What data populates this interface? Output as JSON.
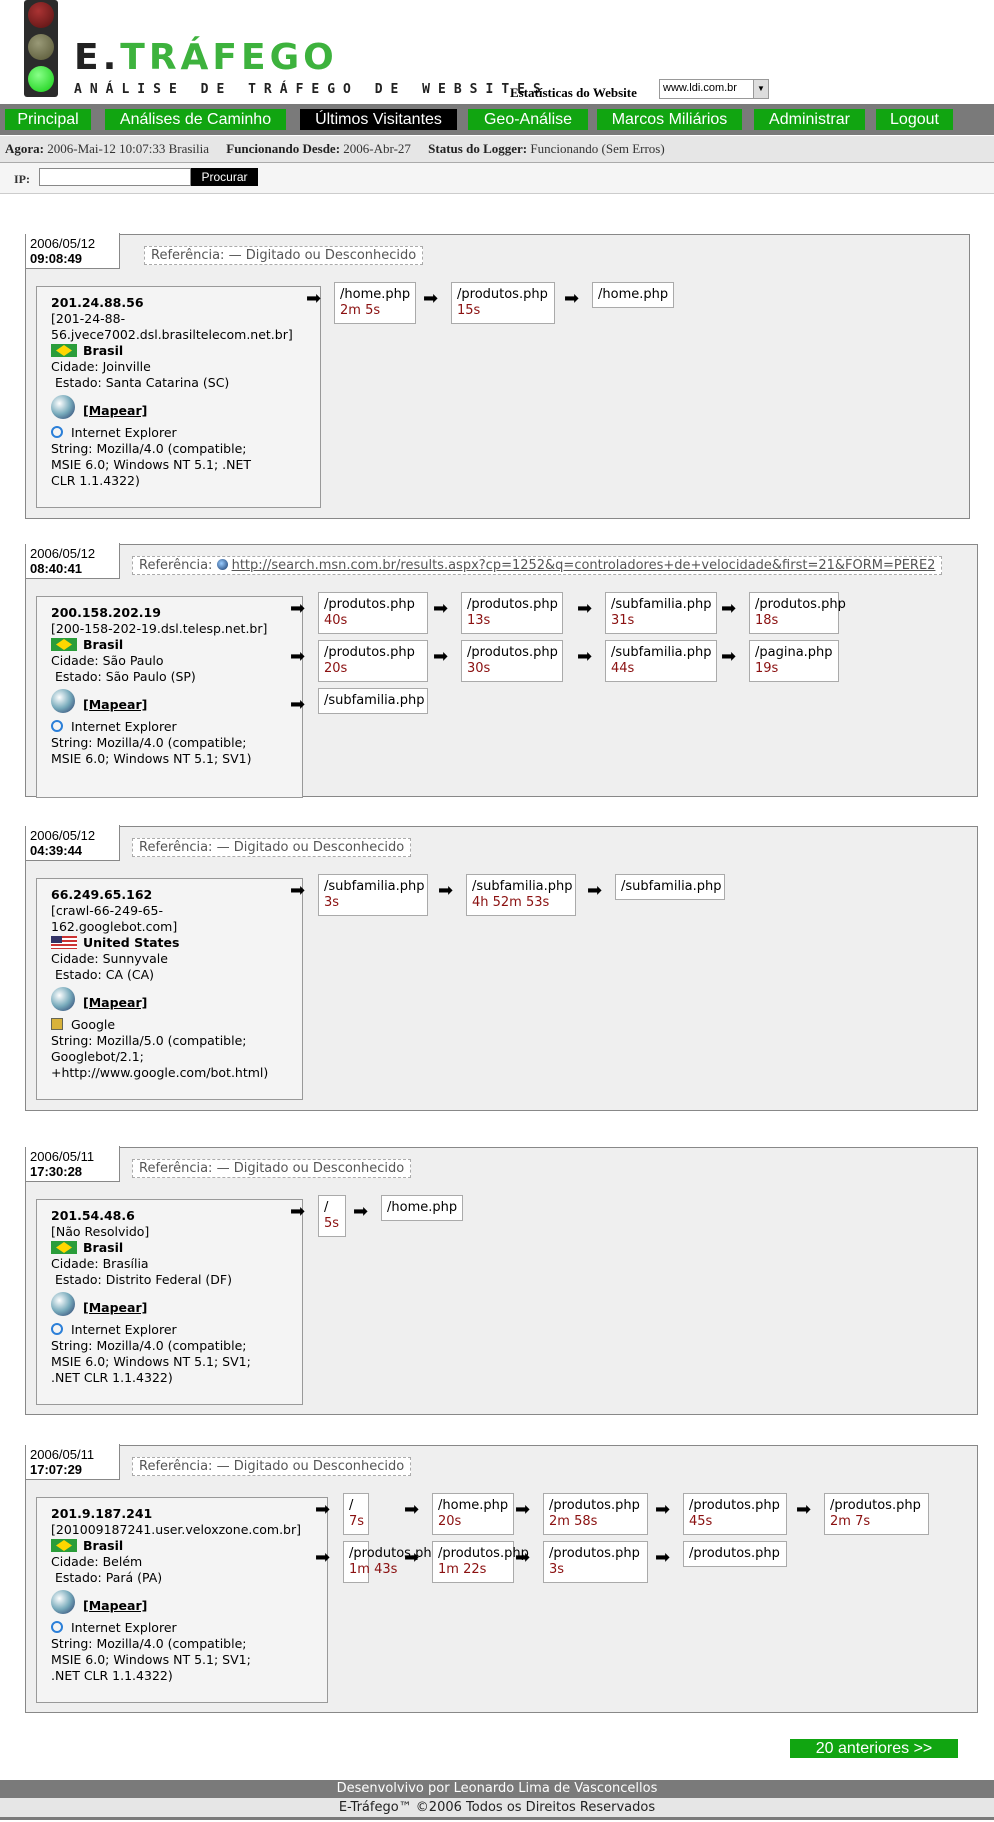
{
  "header": {
    "logo_e": "E.",
    "logo_rest": "TRÁFEGO",
    "tagline": "ANÁLISE DE TRÁFEGO DE WEBSITES",
    "site_label": "Estatísticas do Website",
    "site_value": "www.ldi.com.br"
  },
  "nav": [
    "Principal",
    "Análises de Caminho",
    "Últimos Visitantes",
    "Geo-Análise",
    "Marcos Miliários",
    "Administrar",
    "Logout"
  ],
  "status": {
    "now_label": "Agora:",
    "now_value": "2006-Mai-12 10:07:33 Brasilia",
    "since_label": "Funcionando Desde:",
    "since_value": "2006-Abr-27",
    "logger_label": "Status do Logger:",
    "logger_value": "Funcionando (Sem Erros)"
  },
  "ip_search": {
    "label": "IP:",
    "button": "Procurar"
  },
  "map_link": "[Mapear]",
  "ref_label": "Referência:",
  "visits": [
    {
      "date": "2006/05/12",
      "time": "09:08:49",
      "ref": "—  Digitado ou Desconhecido",
      "ref_is_link": false,
      "ip": "201.24.88.56",
      "host": [
        "[201-24-88-",
        "56.jvece7002.dsl.brasiltelecom.net.br]"
      ],
      "flag": "br",
      "country": "Brasil",
      "city": "Cidade: Joinville",
      "state": " Estado: Santa Catarina (SC)",
      "browser": "Internet Explorer",
      "browser_icon": "ie",
      "ua": [
        "String: Mozilla/4.0 (compatible;",
        "MSIE 6.0; Windows NT 5.1; .NET",
        "CLR 1.1.4322)"
      ],
      "pages": [
        {
          "path": "/home.php",
          "dur": "2m 5s"
        },
        {
          "path": "/produtos.php",
          "dur": "15s"
        },
        {
          "path": "/home.php",
          "dur": ""
        }
      ]
    },
    {
      "date": "2006/05/12",
      "time": "08:40:41",
      "ref": "http://search.msn.com.br/results.aspx?cp=1252&q=controladores+de+velocidade&first=21&FORM=PERE2",
      "ref_is_link": true,
      "ip": "200.158.202.19",
      "host": [
        "[200-158-202-19.dsl.telesp.net.br]"
      ],
      "flag": "br",
      "country": "Brasil",
      "city": "Cidade: São Paulo",
      "state": " Estado: São Paulo (SP)",
      "browser": "Internet Explorer",
      "browser_icon": "ie",
      "ua": [
        "String: Mozilla/4.0 (compatible;",
        "MSIE 6.0; Windows NT 5.1; SV1)"
      ],
      "pages": [
        {
          "path": "/produtos.php",
          "dur": "40s"
        },
        {
          "path": "/produtos.php",
          "dur": "13s"
        },
        {
          "path": "/subfamilia.php",
          "dur": "31s"
        },
        {
          "path": "/produtos.php",
          "dur": "18s"
        },
        {
          "path": "/produtos.php",
          "dur": "20s"
        },
        {
          "path": "/produtos.php",
          "dur": "30s"
        },
        {
          "path": "/subfamilia.php",
          "dur": "44s"
        },
        {
          "path": "/pagina.php",
          "dur": "19s"
        },
        {
          "path": "/subfamilia.php",
          "dur": ""
        }
      ]
    },
    {
      "date": "2006/05/12",
      "time": "04:39:44",
      "ref": "—  Digitado ou Desconhecido",
      "ref_is_link": false,
      "ip": "66.249.65.162",
      "host": [
        "[crawl-66-249-65-",
        "162.googlebot.com]"
      ],
      "flag": "us",
      "country": "United States",
      "city": "Cidade: Sunnyvale",
      "state": " Estado: CA (CA)",
      "browser": "Google",
      "browser_icon": "bot",
      "ua": [
        "String: Mozilla/5.0 (compatible;",
        "Googlebot/2.1;",
        "+http://www.google.com/bot.html)"
      ],
      "pages": [
        {
          "path": "/subfamilia.php",
          "dur": "3s"
        },
        {
          "path": "/subfamilia.php",
          "dur": "4h 52m 53s"
        },
        {
          "path": "/subfamilia.php",
          "dur": ""
        }
      ]
    },
    {
      "date": "2006/05/11",
      "time": "17:30:28",
      "ref": "—  Digitado ou Desconhecido",
      "ref_is_link": false,
      "ip": "201.54.48.6",
      "host": [
        "[Não Resolvido]"
      ],
      "flag": "br",
      "country": "Brasil",
      "city": "Cidade: Brasília",
      "state": " Estado: Distrito Federal (DF)",
      "browser": "Internet Explorer",
      "browser_icon": "ie",
      "ua": [
        "String: Mozilla/4.0 (compatible;",
        "MSIE 6.0; Windows NT 5.1; SV1;",
        ".NET CLR 1.1.4322)"
      ],
      "pages": [
        {
          "path": "/",
          "dur": "5s"
        },
        {
          "path": "/home.php",
          "dur": ""
        }
      ]
    },
    {
      "date": "2006/05/11",
      "time": "17:07:29",
      "ref": "—  Digitado ou Desconhecido",
      "ref_is_link": false,
      "ip": "201.9.187.241",
      "host": [
        "[201009187241.user.veloxzone.com.br]"
      ],
      "flag": "br",
      "country": "Brasil",
      "city": "Cidade: Belém",
      "state": " Estado: Pará (PA)",
      "browser": "Internet Explorer",
      "browser_icon": "ie",
      "ua": [
        "String: Mozilla/4.0 (compatible;",
        "MSIE 6.0; Windows NT 5.1; SV1;",
        ".NET CLR 1.1.4322)"
      ],
      "pages": [
        {
          "path": "/",
          "dur": "7s"
        },
        {
          "path": "/home.php",
          "dur": "20s"
        },
        {
          "path": "/produtos.php",
          "dur": "2m 58s"
        },
        {
          "path": "/produtos.php",
          "dur": "45s"
        },
        {
          "path": "/produtos.php",
          "dur": "2m 7s"
        },
        {
          "path": "/produtos.php",
          "dur": "1m 43s"
        },
        {
          "path": "/produtos.php",
          "dur": "1m 22s"
        },
        {
          "path": "/produtos.php",
          "dur": "3s"
        },
        {
          "path": "/produtos.php",
          "dur": ""
        }
      ]
    }
  ],
  "pagination": {
    "older": "20 anteriores >>"
  },
  "footer": {
    "line1": "Desenvolvivo por Leonardo Lima de Vasconcellos",
    "line2": "E-Tráfego™ ©2006 Todos os Direitos Reservados"
  }
}
